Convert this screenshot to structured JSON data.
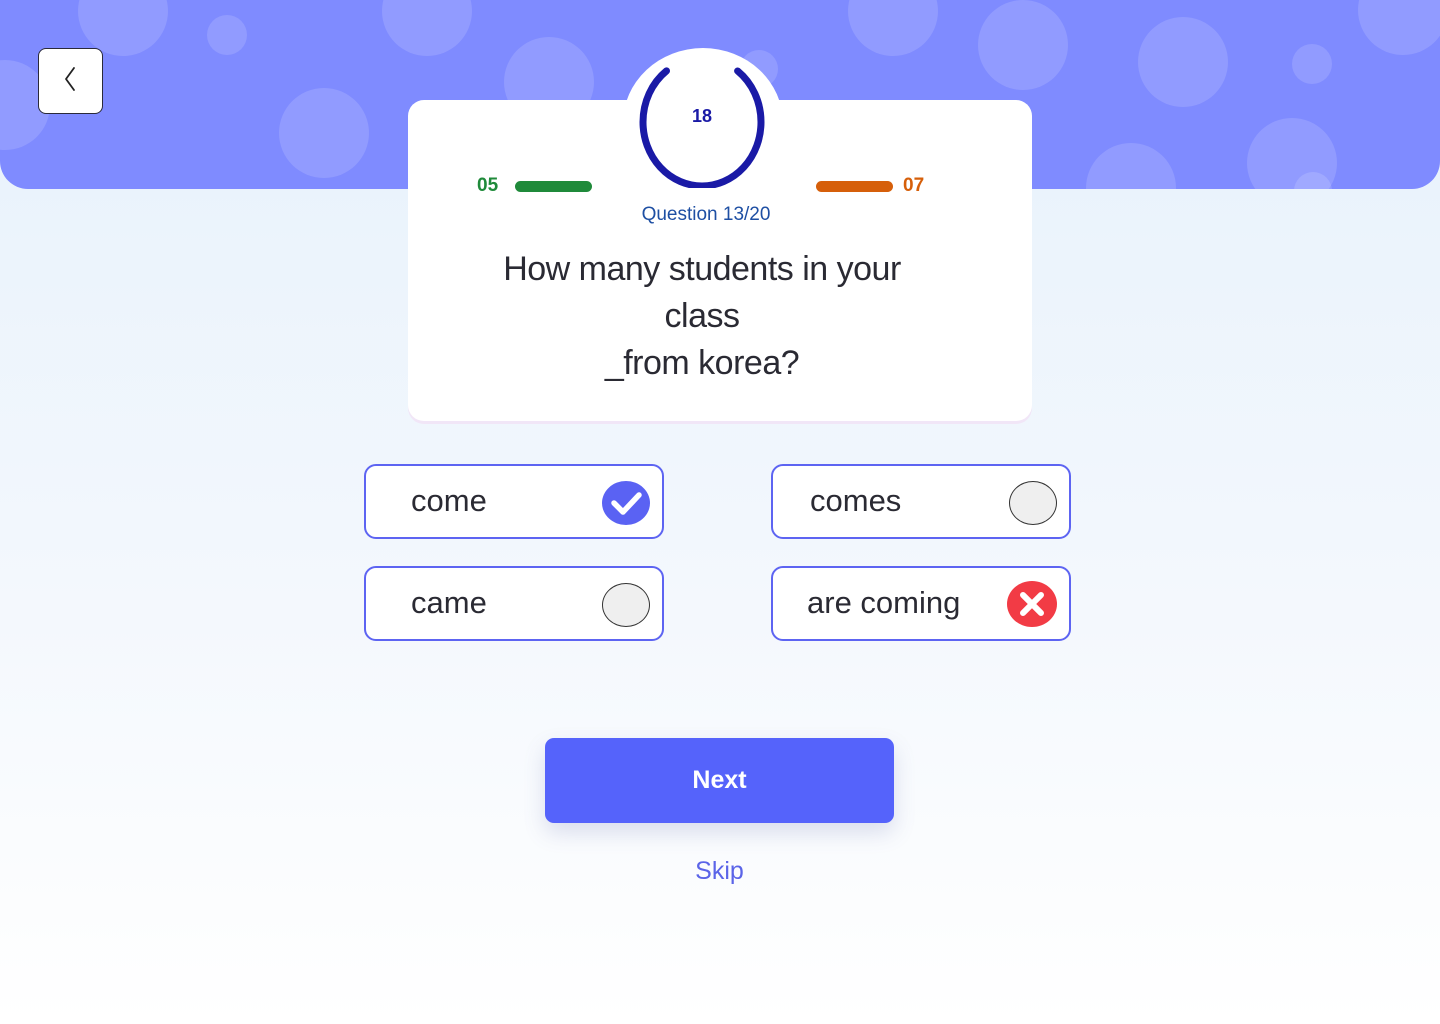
{
  "colors": {
    "banner": "#7f8bff",
    "accent": "#5563fb",
    "timer_ring": "#1a1aa6",
    "correct_score": "#1f8a3a",
    "wrong_score": "#d65f0a",
    "option_border": "#5d64f2",
    "wrong_indicator": "#f23b45"
  },
  "nav": {
    "back_icon": "chevron-left-icon"
  },
  "timer": {
    "value": "18",
    "progress": 0.8
  },
  "score": {
    "correct": "05",
    "wrong": "07"
  },
  "question": {
    "counter": "Question 13/20",
    "text": "How many students in your class _from korea?"
  },
  "options": [
    {
      "label": "come",
      "state": "selected-correct",
      "icon": "check-circle-icon"
    },
    {
      "label": "comes",
      "state": "unselected",
      "icon": "radio-empty-icon"
    },
    {
      "label": "came",
      "state": "unselected",
      "icon": "radio-empty-icon"
    },
    {
      "label": "are coming",
      "state": "wrong",
      "icon": "x-circle-icon"
    }
  ],
  "actions": {
    "next_label": "Next",
    "skip_label": "Skip"
  }
}
